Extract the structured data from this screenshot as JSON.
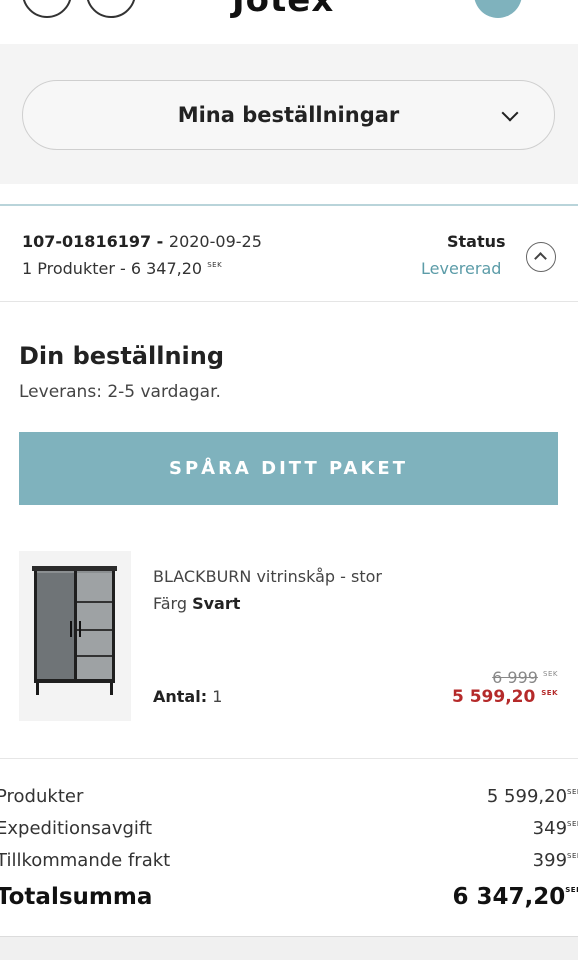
{
  "header": {
    "logo_text": "Jotex"
  },
  "orders_dropdown": {
    "label": "Mina beställningar"
  },
  "order": {
    "number": "107-01816197",
    "date": "2020-09-25",
    "products_count": "1 Produkter",
    "total": "6 347,20",
    "currency": "SEK",
    "status_label": "Status",
    "status_value": "Levererad"
  },
  "details": {
    "title": "Din beställning",
    "delivery": "Leverans: 2-5 vardagar.",
    "track_button": "SPÅRA DITT PAKET"
  },
  "product": {
    "name": "BLACKBURN vitrinskåp - stor",
    "color_label": "Färg",
    "color_value": "Svart",
    "qty_label": "Antal:",
    "qty_value": "1",
    "old_price": "6 999",
    "new_price": "5 599,20",
    "currency": "SEK"
  },
  "summary": {
    "products_label": "Produkter",
    "products_value": "5 599,20",
    "fee_label": "Expeditionsavgift",
    "fee_value": "349",
    "shipping_label": "Tillkommande frakt",
    "shipping_value": "399",
    "total_label": "Totalsumma",
    "total_value": "6 347,20",
    "currency": "SEK"
  },
  "colors": {
    "accent_teal": "#7fb2bd",
    "status_teal": "#5c9ca8",
    "sale_red": "#b52a2a"
  }
}
